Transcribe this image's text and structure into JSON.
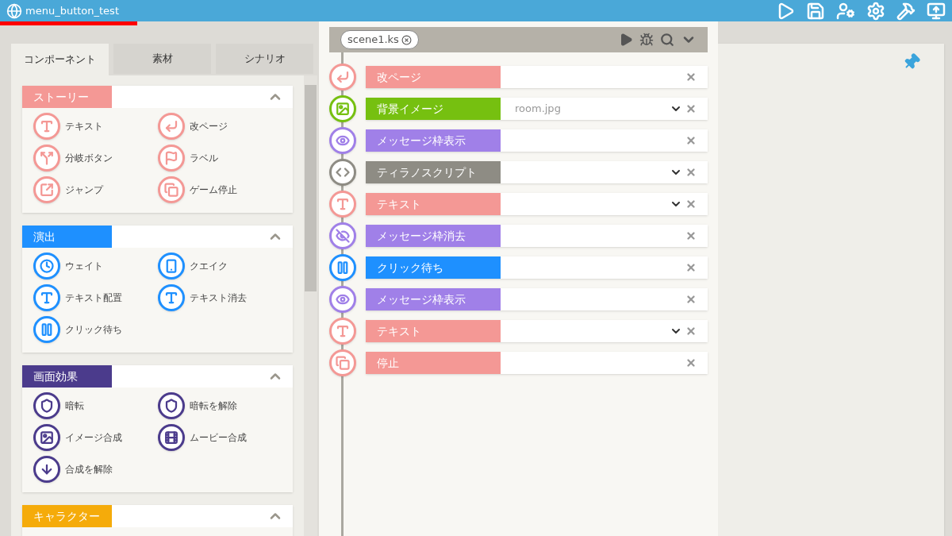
{
  "window": {
    "title": "menu_button_test"
  },
  "tabs": [
    {
      "label": "コンポーネント",
      "selected": true
    },
    {
      "label": "素材",
      "selected": false
    },
    {
      "label": "シナリオ",
      "selected": false
    }
  ],
  "sections": [
    {
      "title": "ストーリー",
      "color": "#f49895",
      "expanded": true,
      "items": [
        {
          "label": "テキスト",
          "kind": "text"
        },
        {
          "label": "改ページ",
          "kind": "newpage"
        },
        {
          "label": "分岐ボタン",
          "kind": "branch"
        },
        {
          "label": "ラベル",
          "kind": "label"
        },
        {
          "label": "ジャンプ",
          "kind": "jump"
        },
        {
          "label": "ゲーム停止",
          "kind": "stop"
        }
      ]
    },
    {
      "title": "演出",
      "color": "#1e90ff",
      "expanded": true,
      "items": [
        {
          "label": "ウェイト",
          "kind": "wait"
        },
        {
          "label": "クエイク",
          "kind": "quake"
        },
        {
          "label": "テキスト配置",
          "kind": "textpos"
        },
        {
          "label": "テキスト消去",
          "kind": "textpos"
        },
        {
          "label": "クリック待ち",
          "kind": "clickwait"
        }
      ]
    },
    {
      "title": "画面効果",
      "color": "#4b3b8c",
      "expanded": true,
      "items": [
        {
          "label": "暗転",
          "kind": "blackout"
        },
        {
          "label": "暗転を解除",
          "kind": "blackout"
        },
        {
          "label": "イメージ合成",
          "kind": "image"
        },
        {
          "label": "ムービー合成",
          "kind": "movie"
        },
        {
          "label": "合成を解除",
          "kind": "uncompose"
        }
      ]
    },
    {
      "title": "キャラクター",
      "color": "#f5ab0a",
      "expanded": true
    }
  ],
  "editor": {
    "file_tab": "scene1.ks",
    "rows": [
      {
        "label": "改ページ",
        "kind": "newpage",
        "color": "#f49895",
        "dropdown": false
      },
      {
        "label": "背景イメージ",
        "kind": "bgimage",
        "color": "#76c010",
        "value": "room.jpg",
        "dropdown": true
      },
      {
        "label": "メッセージ枠表示",
        "kind": "msgshow",
        "color": "#a080e8",
        "dropdown": false
      },
      {
        "label": "ティラノスクリプト",
        "kind": "script",
        "color": "#8e8c84",
        "dropdown": true
      },
      {
        "label": "テキスト",
        "kind": "text",
        "color": "#f49895",
        "dropdown": true
      },
      {
        "label": "メッセージ枠消去",
        "kind": "msghide",
        "color": "#a080e8",
        "dropdown": false
      },
      {
        "label": "クリック待ち",
        "kind": "clickwait",
        "color": "#1e90ff",
        "dropdown": false
      },
      {
        "label": "メッセージ枠表示",
        "kind": "msgshow",
        "color": "#a080e8",
        "dropdown": false
      },
      {
        "label": "テキスト",
        "kind": "text",
        "color": "#f49895",
        "dropdown": true
      },
      {
        "label": "停止",
        "kind": "stop",
        "color": "#f49895",
        "dropdown": false
      }
    ]
  }
}
